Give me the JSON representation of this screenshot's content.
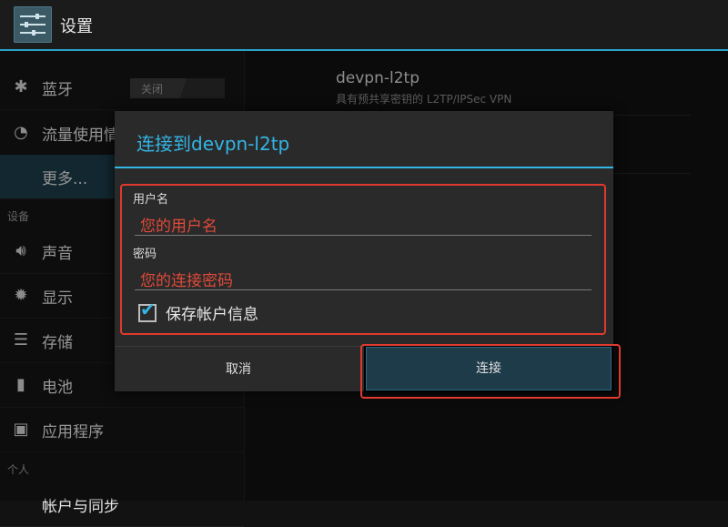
{
  "actionbar": {
    "title": "设置"
  },
  "left": {
    "bluetooth": {
      "label": "蓝牙",
      "toggle": "关闭"
    },
    "data_usage": {
      "label": "流量使用情况"
    },
    "more": {
      "label": "更多..."
    },
    "section_device": "设备",
    "sound": {
      "label": "声音"
    },
    "display": {
      "label": "显示"
    },
    "storage": {
      "label": "存储"
    },
    "battery": {
      "label": "电池"
    },
    "apps": {
      "label": "应用程序"
    },
    "section_personal": "个人",
    "cut_item": {
      "label": "帐户与同步"
    }
  },
  "right": {
    "vpn_name": "devpn-l2tp",
    "vpn_desc": "具有预共享密钥的 L2TP/IPSec VPN"
  },
  "dialog": {
    "title": "连接到devpn-l2tp",
    "username_label": "用户名",
    "username_value": "您的用户名",
    "password_label": "密码",
    "password_value": "您的连接密码",
    "save_label": "保存帐户信息",
    "save_checked": true,
    "cancel": "取消",
    "connect": "连接"
  },
  "colors": {
    "accent": "#33b5e5",
    "highlight": "#e03a2f"
  }
}
